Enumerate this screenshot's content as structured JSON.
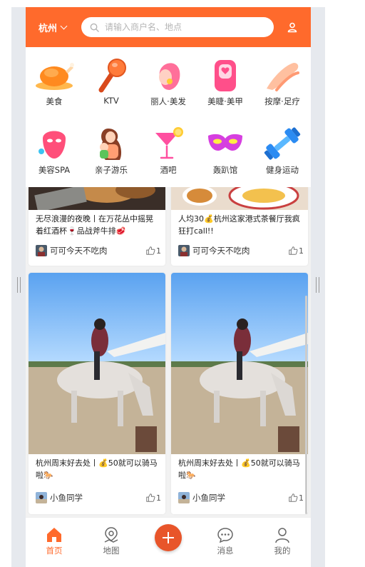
{
  "header": {
    "city": "杭州",
    "search_placeholder": "请输入商户名、地点"
  },
  "categories": [
    {
      "label": "美食",
      "icon": "roast-chicken-icon"
    },
    {
      "label": "KTV",
      "icon": "microphone-icon"
    },
    {
      "label": "丽人·美发",
      "icon": "hair-woman-icon"
    },
    {
      "label": "美睫·美甲",
      "icon": "nail-polish-icon"
    },
    {
      "label": "按摩·足疗",
      "icon": "massage-hand-icon"
    },
    {
      "label": "美容SPA",
      "icon": "face-mask-icon"
    },
    {
      "label": "亲子游乐",
      "icon": "parent-child-icon"
    },
    {
      "label": "酒吧",
      "icon": "cocktail-icon"
    },
    {
      "label": "轰趴馆",
      "icon": "party-mask-icon"
    },
    {
      "label": "健身运动",
      "icon": "dumbbell-icon"
    }
  ],
  "feed": [
    {
      "title": "无尽浪漫的夜晚丨在万花丛中摇晃着红酒杯🍷品战斧牛排🥩",
      "author": "可可今天不吃肉",
      "likes": "1"
    },
    {
      "title": "人均30💰杭州这家港式茶餐厅我疯狂打call!!",
      "author": "可可今天不吃肉",
      "likes": "1"
    },
    {
      "title": "杭州周末好去处丨💰50就可以骑马啦🐎",
      "author": "小鱼同学",
      "likes": "1"
    },
    {
      "title": "杭州周末好去处丨💰50就可以骑马啦🐎",
      "author": "小鱼同学",
      "likes": "1"
    }
  ],
  "tabbar": [
    {
      "label": "首页",
      "icon": "home-icon",
      "active": true
    },
    {
      "label": "地图",
      "icon": "map-pin-icon"
    },
    {
      "label": "",
      "icon": "plus-icon"
    },
    {
      "label": "消息",
      "icon": "chat-bubble-icon"
    },
    {
      "label": "我的",
      "icon": "profile-icon"
    }
  ],
  "colors": {
    "accent": "#ff6a2c",
    "plus_button": "#e8552a"
  }
}
